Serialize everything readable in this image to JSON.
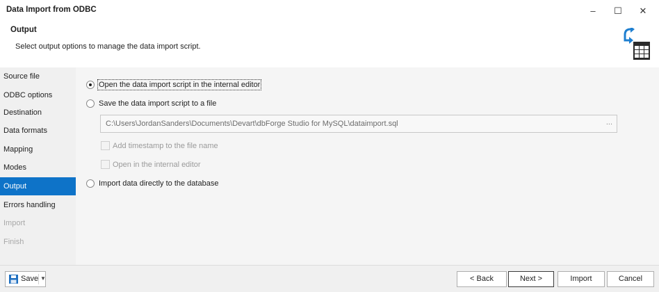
{
  "window": {
    "title": "Data Import from ODBC",
    "minimize_glyph": "–",
    "maximize_glyph": "☐",
    "close_glyph": "✕"
  },
  "header": {
    "title": "Output",
    "subtitle": "Select output options to manage the data import script.",
    "icon": "import-table-icon"
  },
  "sidebar": {
    "items": [
      {
        "label": "Source file",
        "state": "normal"
      },
      {
        "label": "ODBC options",
        "state": "normal"
      },
      {
        "label": "Destination",
        "state": "normal"
      },
      {
        "label": "Data formats",
        "state": "normal"
      },
      {
        "label": "Mapping",
        "state": "normal"
      },
      {
        "label": "Modes",
        "state": "normal"
      },
      {
        "label": "Output",
        "state": "active"
      },
      {
        "label": "Errors handling",
        "state": "normal"
      },
      {
        "label": "Import",
        "state": "disabled"
      },
      {
        "label": "Finish",
        "state": "disabled"
      }
    ]
  },
  "options": {
    "open_in_editor": {
      "label": "Open the data import script in the internal editor",
      "selected": true
    },
    "save_to_file": {
      "label": "Save the data import script to a file",
      "selected": false
    },
    "file_path": "C:\\Users\\JordanSanders\\Documents\\Devart\\dbForge Studio for MySQL\\dataimport.sql",
    "browse_label": "...",
    "add_timestamp": {
      "label": "Add timestamp to the file name",
      "checked": false,
      "enabled": false
    },
    "open_internal": {
      "label": "Open in the internal editor",
      "checked": false,
      "enabled": false
    },
    "import_directly": {
      "label": "Import data directly to the database",
      "selected": false
    }
  },
  "footer": {
    "save_label": "Save",
    "back_label": "< Back",
    "next_label": "Next >",
    "import_label": "Import",
    "cancel_label": "Cancel"
  },
  "colors": {
    "accent": "#0e73c8",
    "sidebar_bg": "#f0f0f0",
    "panel_bg": "#f5f5f5"
  }
}
